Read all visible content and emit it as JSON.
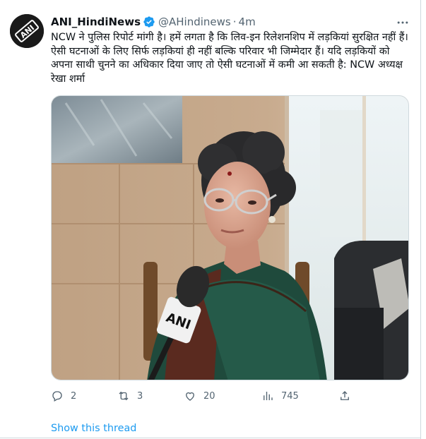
{
  "tweet": {
    "author_name": "ANI_HindiNews",
    "handle": "@AHindinews",
    "separator": "·",
    "time": "4m",
    "text": "NCW ने पुलिस रिपोर्ट मांगी है। हमें लगता है कि लिव-इन रिलेशनशिप में लड़कियां सुरक्षित नहीं हैं। ऐसी घटनाओं के लिए सिर्फ लड़कियां ही नहीं बल्कि परिवार भी जिम्मेदार हैं। यदि लड़कियों को अपना साथी चुनने का अधिकार दिया जाए तो ऐसी घटनाओं में कमी आ सकती है: NCW अध्यक्ष रेखा शर्मा",
    "avatar_logo": "ANI",
    "mic_logo": "ANI",
    "verified_color": "#1d9bf0"
  },
  "actions": {
    "replies": "2",
    "retweets": "3",
    "likes": "20",
    "views": "745"
  },
  "show_thread_label": "Show this thread",
  "icons": [
    "verified-badge-icon",
    "more-icon",
    "reply-icon",
    "retweet-icon",
    "like-icon",
    "views-icon",
    "share-icon"
  ],
  "colors": {
    "link": "#1d9bf0",
    "muted": "#536471",
    "text": "#0f1419"
  }
}
